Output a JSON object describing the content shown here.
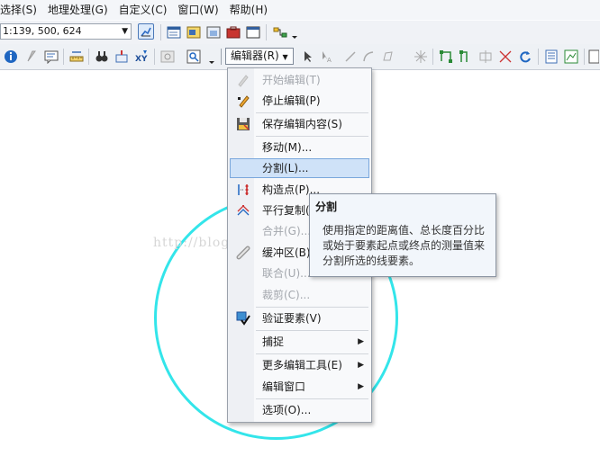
{
  "menubar": {
    "items": [
      "选择(S)",
      "地理处理(G)",
      "自定义(C)",
      "窗口(W)",
      "帮助(H)"
    ]
  },
  "toolbar": {
    "scale_value": "1:139, 500, 624",
    "editor_label": "编辑器(R)"
  },
  "watermark": "http://blog.csdn.net/",
  "editor_menu": {
    "items": [
      {
        "label": "开始编辑(T)",
        "enabled": false,
        "icon": "pencil-icon"
      },
      {
        "label": "停止编辑(P)",
        "enabled": true,
        "icon": "edit-pencil-icon"
      },
      {
        "label": "保存编辑内容(S)",
        "enabled": true,
        "icon": "save-icon"
      },
      {
        "label": "移动(M)...",
        "enabled": true,
        "icon": ""
      },
      {
        "label": "分割(L)...",
        "enabled": true,
        "icon": "",
        "highlighted": true
      },
      {
        "label": "构造点(P)...",
        "enabled": true,
        "icon": "construct-points-icon"
      },
      {
        "label": "平行复制(C)...",
        "enabled": true,
        "icon": "copy-parallel-icon"
      },
      {
        "label": "合并(G)...",
        "enabled": false,
        "icon": ""
      },
      {
        "label": "缓冲区(B)...",
        "enabled": true,
        "icon": "buffer-icon"
      },
      {
        "label": "联合(U)...",
        "enabled": false,
        "icon": ""
      },
      {
        "label": "裁剪(C)...",
        "enabled": false,
        "icon": ""
      },
      {
        "label": "验证要素(V)",
        "enabled": true,
        "icon": "validate-icon"
      },
      {
        "label": "捕捉",
        "enabled": true,
        "icon": "",
        "submenu": true
      },
      {
        "label": "更多编辑工具(E)",
        "enabled": true,
        "icon": "",
        "submenu": true
      },
      {
        "label": "编辑窗口",
        "enabled": true,
        "icon": "",
        "submenu": true
      },
      {
        "label": "选项(O)...",
        "enabled": true,
        "icon": ""
      }
    ]
  },
  "tooltip": {
    "title": "分割",
    "body": "使用指定的距离值、总长度百分比或始于要素起点或终点的测量值来分割所选的线要素。"
  },
  "colors": {
    "circle": "#33e5ea",
    "highlight": "#cfe2f8"
  }
}
